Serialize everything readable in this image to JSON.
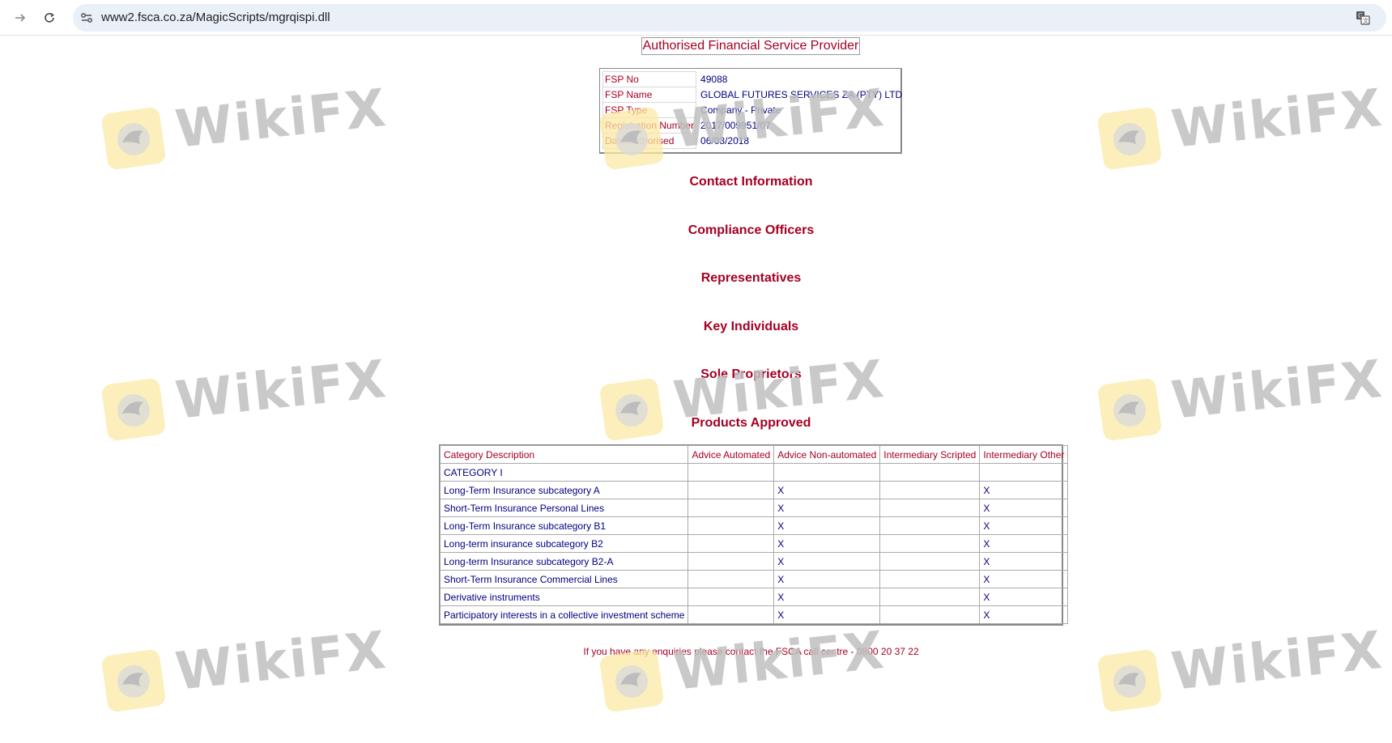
{
  "browser": {
    "url": "www2.fsca.co.za/MagicScripts/mgrqispi.dll"
  },
  "page": {
    "title": "Authorised Financial Service Provider"
  },
  "details": [
    {
      "label": "FSP No",
      "value": "49088"
    },
    {
      "label": "FSP Name",
      "value": "GLOBAL FUTURES SERVICES ZA (PTY) LTD"
    },
    {
      "label": "FSP Type",
      "value": "Company - Private"
    },
    {
      "label": "Registration Number",
      "value": "2017/009951/07"
    },
    {
      "label": "Date Authorised",
      "value": "06/03/2018"
    }
  ],
  "sections": {
    "contact": "Contact Information",
    "compliance": "Compliance Officers",
    "representatives": "Representatives",
    "key_individuals": "Key Individuals",
    "sole_proprietors": "Sole Proprietors",
    "products": "Products Approved"
  },
  "products_table": {
    "headers": [
      "Category Description",
      "Advice Automated",
      "Advice Non-automated",
      "Intermediary Scripted",
      "Intermediary Other"
    ],
    "rows": [
      [
        "CATEGORY I",
        "",
        "",
        "",
        ""
      ],
      [
        "Long-Term Insurance subcategory A",
        "",
        "X",
        "",
        "X"
      ],
      [
        "Short-Term Insurance Personal Lines",
        "",
        "X",
        "",
        "X"
      ],
      [
        "Long-Term Insurance subcategory B1",
        "",
        "X",
        "",
        "X"
      ],
      [
        "Long-term insurance subcategory B2",
        "",
        "X",
        "",
        "X"
      ],
      [
        "Long-term Insurance subcategory B2-A",
        "",
        "X",
        "",
        "X"
      ],
      [
        "Short-Term Insurance Commercial Lines",
        "",
        "X",
        "",
        "X"
      ],
      [
        "Derivative instruments",
        "",
        "X",
        "",
        "X"
      ],
      [
        "Participatory interests in a collective investment scheme",
        "",
        "X",
        "",
        "X"
      ]
    ]
  },
  "footer": {
    "note": "If you have any enquiries please contact the FSCA call centre - 0800 20 37 22"
  },
  "watermark": {
    "text": "WikiFX",
    "color": "#c0c0c0",
    "logo_color": "#fbe9a6"
  },
  "colors": {
    "label": "#a50021",
    "value": "#000080"
  }
}
